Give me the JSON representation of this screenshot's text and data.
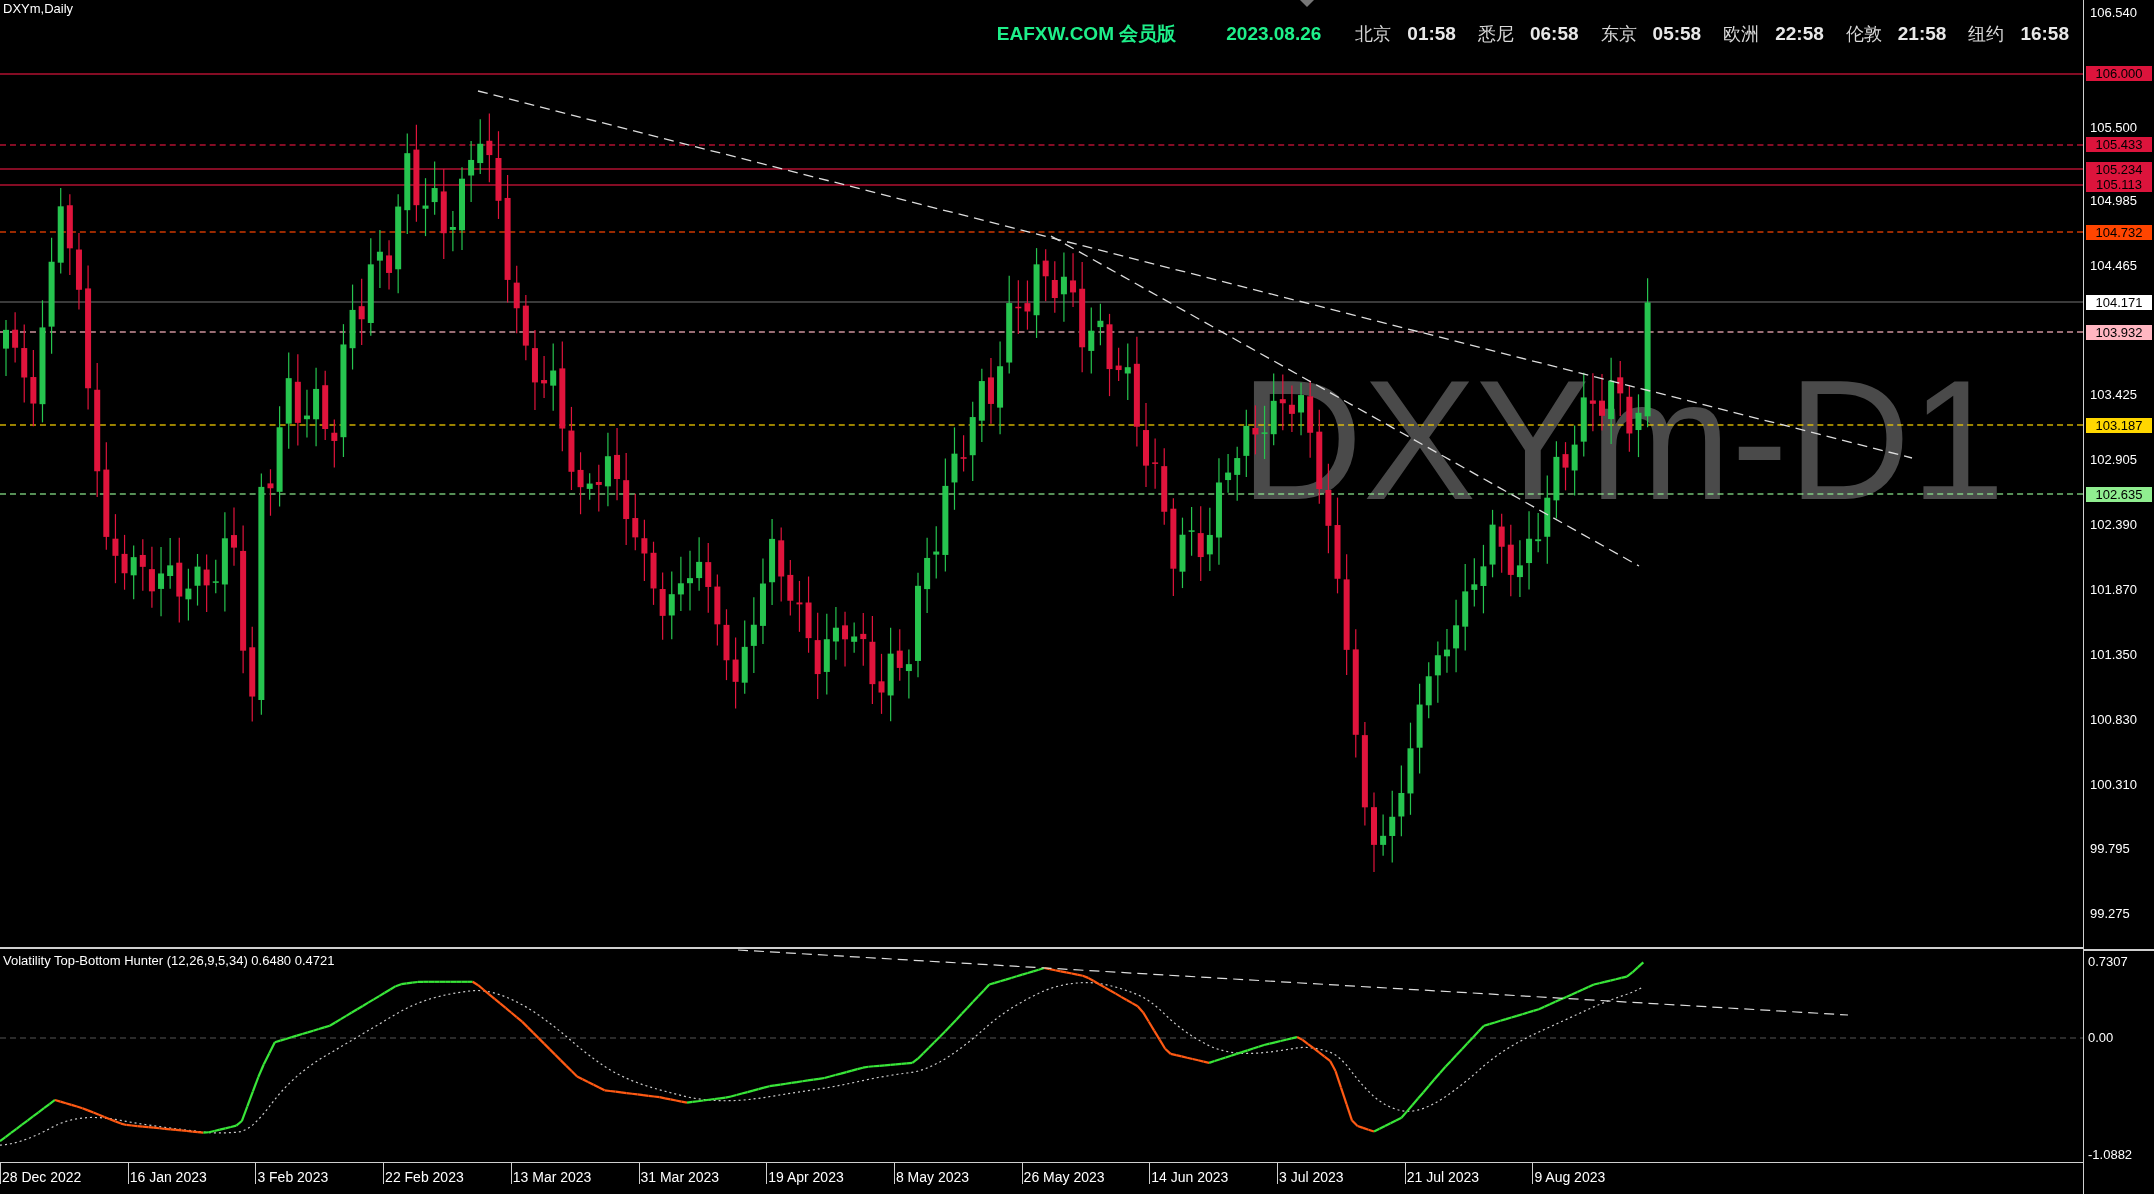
{
  "chart": {
    "title": "DXYm,Daily",
    "symbol_label": "DXYm-D1"
  },
  "header": {
    "brand": "EAFXW.COM 会员版",
    "date": "2023.08.26",
    "clocks": [
      {
        "city": "北京",
        "time": "01:58"
      },
      {
        "city": "悉尼",
        "time": "06:58"
      },
      {
        "city": "东京",
        "time": "05:58"
      },
      {
        "city": "欧洲",
        "time": "22:58"
      },
      {
        "city": "伦敦",
        "time": "21:58"
      },
      {
        "city": "纽约",
        "time": "16:58"
      }
    ]
  },
  "price_axis": [
    "106.540",
    "105.500",
    "104.985",
    "104.465",
    "103.425",
    "102.905",
    "102.390",
    "101.870",
    "101.350",
    "100.830",
    "100.310",
    "99.795",
    "99.275"
  ],
  "price_levels": [
    {
      "value": "106.000",
      "color": "#dc143c",
      "dashed": false,
      "kind": "level"
    },
    {
      "value": "105.433",
      "color": "#dc143c",
      "dashed": true,
      "kind": "level"
    },
    {
      "value": "105.234",
      "color": "#dc143c",
      "dashed": false,
      "kind": "level"
    },
    {
      "value": "105.113",
      "color": "#dc143c",
      "dashed": false,
      "kind": "level"
    },
    {
      "value": "104.732",
      "color": "#ff4500",
      "dashed": true,
      "kind": "level"
    },
    {
      "value": "104.171",
      "color": "#ffffff",
      "dashed": false,
      "kind": "bid"
    },
    {
      "value": "103.932",
      "color": "#ffb6c1",
      "dashed": true,
      "kind": "level"
    },
    {
      "value": "103.187",
      "color": "#ffd700",
      "dashed": true,
      "kind": "level"
    },
    {
      "value": "102.635",
      "color": "#90ee90",
      "dashed": true,
      "kind": "level"
    }
  ],
  "indicator": {
    "label": "Volatility Top-Bottom Hunter (12,26,9,5,34) 0.6480 0.4721",
    "axis": [
      "0.7307",
      "0.00",
      "-1.0882"
    ]
  },
  "date_axis": [
    "28 Dec 2022",
    "16 Jan 2023",
    "3 Feb 2023",
    "22 Feb 2023",
    "13 Mar 2023",
    "31 Mar 2023",
    "19 Apr 2023",
    "8 May 2023",
    "26 May 2023",
    "14 Jun 2023",
    "3 Jul 2023",
    "21 Jul 2023",
    "9 Aug 2023"
  ]
}
